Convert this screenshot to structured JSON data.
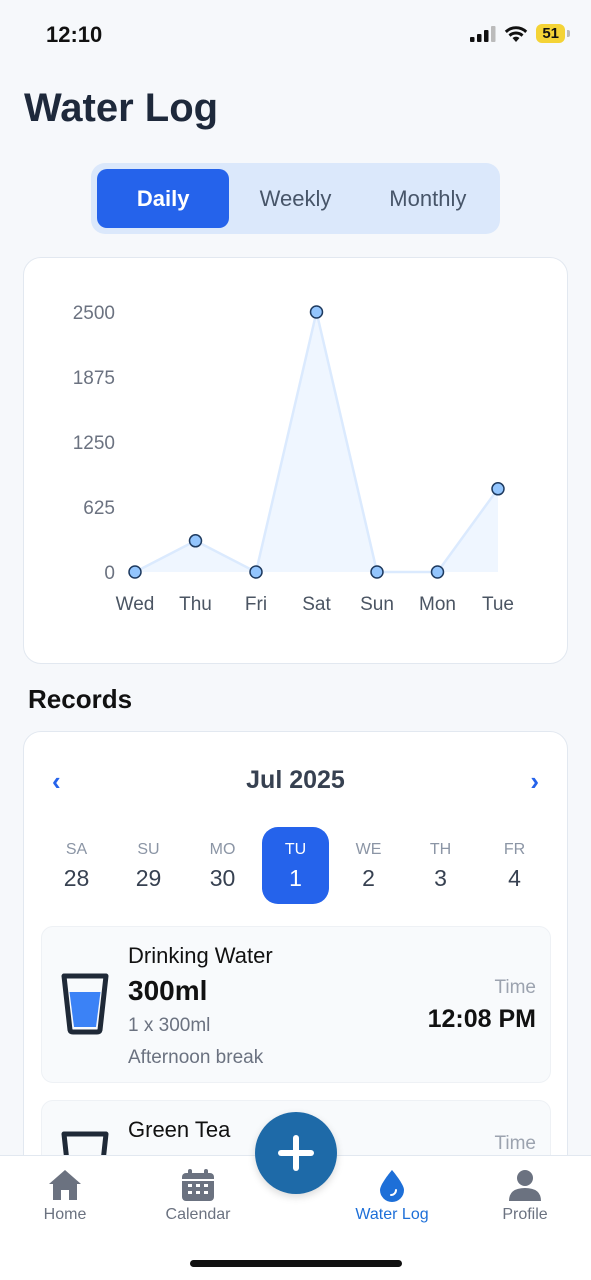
{
  "status": {
    "time": "12:10",
    "battery": "51"
  },
  "title": "Water Log",
  "tabs_period": [
    {
      "label": "Daily",
      "active": true
    },
    {
      "label": "Weekly",
      "active": false
    },
    {
      "label": "Monthly",
      "active": false
    }
  ],
  "chart_data": {
    "type": "area",
    "categories": [
      "Wed",
      "Thu",
      "Fri",
      "Sat",
      "Sun",
      "Mon",
      "Tue"
    ],
    "values": [
      0,
      300,
      0,
      2500,
      0,
      0,
      800
    ],
    "y_ticks": [
      "2500",
      "1875",
      "1250",
      "625",
      "0"
    ],
    "ylim": [
      0,
      2500
    ],
    "grid": false,
    "colors": {
      "line": "#dbeafe",
      "fill": "#eff6ff",
      "point": "#93c5fd",
      "point_stroke": "#1e3a5f"
    }
  },
  "records": {
    "title": "Records",
    "month": "Jul 2025",
    "prev_icon": "chevron-left-icon",
    "next_icon": "chevron-right-icon",
    "days": [
      {
        "name": "SA",
        "date": "28",
        "active": false
      },
      {
        "name": "SU",
        "date": "29",
        "active": false
      },
      {
        "name": "MO",
        "date": "30",
        "active": false
      },
      {
        "name": "TU",
        "date": "1",
        "active": true
      },
      {
        "name": "WE",
        "date": "2",
        "active": false
      },
      {
        "name": "TH",
        "date": "3",
        "active": false
      },
      {
        "name": "FR",
        "date": "4",
        "active": false
      }
    ],
    "items": [
      {
        "name": "Drinking Water",
        "amount": "300ml",
        "detail": "1 x 300ml",
        "note": "Afternoon break",
        "time_label": "Time",
        "time": "12:08 PM",
        "icon": "water-glass-icon"
      },
      {
        "name": "Green Tea",
        "time_label": "Time",
        "icon": "cup-icon"
      }
    ]
  },
  "nav": [
    {
      "label": "Home",
      "icon": "home-icon",
      "active": false
    },
    {
      "label": "Calendar",
      "icon": "calendar-icon",
      "active": false
    },
    {
      "label": "Water Log",
      "icon": "water-drop-icon",
      "active": true
    },
    {
      "label": "Profile",
      "icon": "profile-icon",
      "active": false
    }
  ],
  "fab_icon": "plus-icon",
  "accent": "#2563eb"
}
